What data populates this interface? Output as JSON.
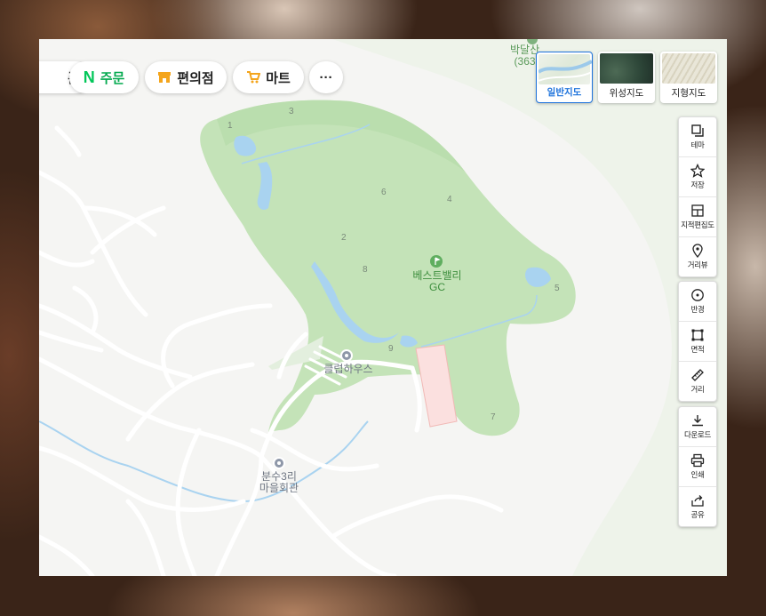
{
  "categories": [
    {
      "id": "coupon",
      "label": "폰"
    },
    {
      "id": "order",
      "label": "주문",
      "prefix": "N"
    },
    {
      "id": "convenience",
      "label": "편의점"
    },
    {
      "id": "mart",
      "label": "마트"
    },
    {
      "id": "more",
      "label": "···"
    }
  ],
  "map_types": [
    {
      "id": "normal",
      "label": "일반지도",
      "active": true
    },
    {
      "id": "satellite",
      "label": "위성지도",
      "active": false
    },
    {
      "id": "terrain",
      "label": "지형지도",
      "active": false
    }
  ],
  "tools": {
    "group1": [
      {
        "label": "테마",
        "icon": "layers-icon"
      },
      {
        "label": "저장",
        "icon": "star-icon"
      },
      {
        "label": "지적편집도",
        "icon": "cadastral-icon"
      },
      {
        "label": "거리뷰",
        "icon": "street-view-icon"
      }
    ],
    "group2": [
      {
        "label": "반경",
        "icon": "radius-icon"
      },
      {
        "label": "면적",
        "icon": "area-icon"
      },
      {
        "label": "거리",
        "icon": "ruler-icon"
      }
    ],
    "group3": [
      {
        "label": "다운로드",
        "icon": "download-icon"
      },
      {
        "label": "인쇄",
        "icon": "print-icon"
      },
      {
        "label": "공유",
        "icon": "share-icon"
      }
    ]
  },
  "places": {
    "golf": {
      "line1": "베스트밸리",
      "line2": "GC"
    },
    "clubhouse": "클럽하우스",
    "village": {
      "line1": "분수3리",
      "line2": "마을회관"
    },
    "mountain": {
      "line1": "박달산",
      "line2": "(363"
    }
  },
  "holes": [
    "1",
    "2",
    "3",
    "4",
    "5",
    "6",
    "7",
    "8",
    "9"
  ],
  "colors": {
    "accent": "#1e73dc",
    "golf_green": "#c4e3b8",
    "water": "#a9d3f0",
    "road": "#ffffff",
    "background": "#f5f5f3"
  }
}
